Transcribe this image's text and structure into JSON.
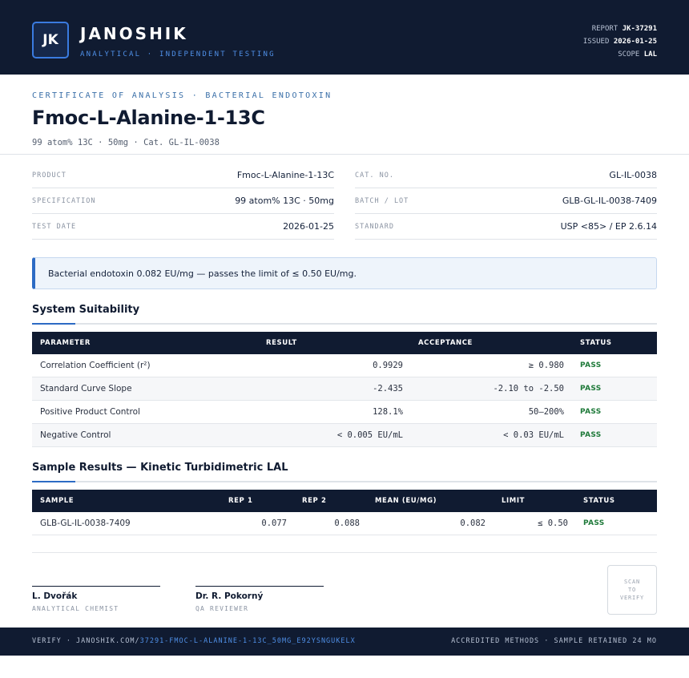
{
  "header": {
    "logo_text": "JK",
    "brand": "JANOSHIK",
    "tagline": "ANALYTICAL · INDEPENDENT TESTING",
    "report_label": "REPORT",
    "report_value": "JK-37291",
    "issued_label": "ISSUED",
    "issued_value": "2026-01-25",
    "scope_label": "SCOPE",
    "scope_value": "LAL",
    "colors": {
      "navy": "#101b31",
      "accent": "#2d6bc4",
      "pass": "#1f7a3a"
    }
  },
  "title": {
    "eyebrow": "CERTIFICATE OF ANALYSIS · BACTERIAL ENDOTOXIN",
    "product": "Fmoc-L-Alanine-1-13C",
    "subtitle": "99 atom% 13C · 50mg  ·  Cat. GL-IL-0038"
  },
  "info": {
    "left": [
      {
        "label": "PRODUCT",
        "value": "Fmoc-L-Alanine-1-13C"
      },
      {
        "label": "SPECIFICATION",
        "value": "99 atom% 13C · 50mg"
      },
      {
        "label": "TEST DATE",
        "value": "2026-01-25"
      }
    ],
    "right": [
      {
        "label": "CAT. NO.",
        "value": "GL-IL-0038"
      },
      {
        "label": "BATCH / LOT",
        "value": "GLB-GL-IL-0038-7409"
      },
      {
        "label": "STANDARD",
        "value": "USP <85> / EP 2.6.14"
      }
    ]
  },
  "banner": {
    "text": "Bacterial endotoxin 0.082 EU/mg — passes the limit of ≤ 0.50 EU/mg."
  },
  "suitability": {
    "title": "System Suitability",
    "headers": [
      "PARAMETER",
      "RESULT",
      "ACCEPTANCE",
      "STATUS"
    ],
    "rows": [
      {
        "parameter": "Correlation Coefficient (r²)",
        "result": "0.9929",
        "acceptance": "≥ 0.980",
        "status": "PASS"
      },
      {
        "parameter": "Standard Curve Slope",
        "result": "-2.435",
        "acceptance": "-2.10 to -2.50",
        "status": "PASS"
      },
      {
        "parameter": "Positive Product Control",
        "result": "128.1%",
        "acceptance": "50–200%",
        "status": "PASS"
      },
      {
        "parameter": "Negative Control",
        "result": "< 0.005 EU/mL",
        "acceptance": "< 0.03 EU/mL",
        "status": "PASS"
      }
    ]
  },
  "samples": {
    "title": "Sample Results — Kinetic Turbidimetric LAL",
    "headers": [
      "SAMPLE",
      "REP 1",
      "REP 2",
      "MEAN (EU/MG)",
      "LIMIT",
      "STATUS"
    ],
    "rows": [
      {
        "sample": "GLB-GL-IL-0038-7409",
        "rep1": "0.077",
        "rep2": "0.088",
        "mean": "0.082",
        "limit": "≤ 0.50",
        "status": "PASS"
      }
    ]
  },
  "signatures": [
    {
      "name": "L. Dvořák",
      "role": "ANALYTICAL CHEMIST"
    },
    {
      "name": "Dr. R. Pokorný",
      "role": "QA REVIEWER"
    }
  ],
  "qr": {
    "line1": "SCAN",
    "line2": "TO",
    "line3": "VERIFY"
  },
  "footer": {
    "verify_prefix": "VERIFY · JANOSHIK.COM/",
    "verify_link": "37291-FMOC-L-ALANINE-1-13C_50MG_E92YSNGUKELX",
    "right": "ACCREDITED METHODS · SAMPLE RETAINED 24 MO"
  }
}
